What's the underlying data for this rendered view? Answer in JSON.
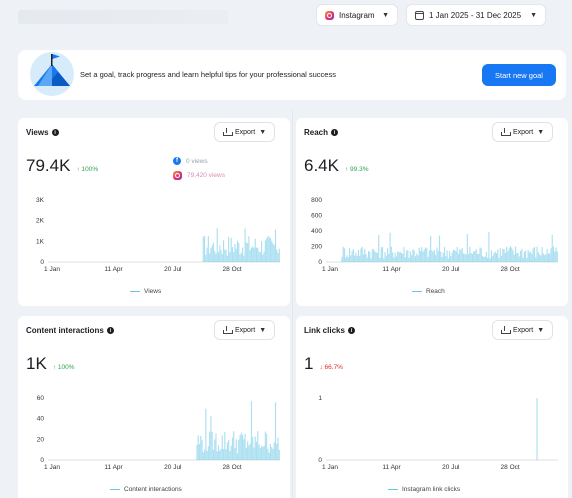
{
  "topbar": {
    "platform_label": "Instagram",
    "date_range_label": "1 Jan 2025 - 31 Dec 2025"
  },
  "goal_banner": {
    "text": "Set a goal, track progress and learn helpful tips for your professional success",
    "button_label": "Start new goal"
  },
  "export_label": "Export",
  "colors": {
    "accent": "#1877f2",
    "series": "#66c7e6",
    "up": "#31a24c",
    "down": "#e02e2e"
  },
  "cards": {
    "views": {
      "title": "Views",
      "value": "79.4K",
      "delta": "100%",
      "delta_direction": "up",
      "breakdown_facebook": "0 views",
      "breakdown_instagram": "79,420 views",
      "legend": "Views"
    },
    "reach": {
      "title": "Reach",
      "value": "6.4K",
      "delta": "99.3%",
      "delta_direction": "up",
      "legend": "Reach"
    },
    "content_interactions": {
      "title": "Content interactions",
      "value": "1K",
      "delta": "100%",
      "delta_direction": "up",
      "legend": "Content interactions"
    },
    "link_clicks": {
      "title": "Link clicks",
      "value": "1",
      "delta": "66.7%",
      "delta_direction": "down",
      "legend": "Instagram link clicks"
    }
  },
  "chart_data": [
    {
      "type": "area",
      "name": "views",
      "x_ticks": [
        "1 Jan",
        "11 Apr",
        "20 Jul",
        "28 Oct"
      ],
      "y_ticks": [
        "0",
        "1K",
        "2K",
        "3K"
      ],
      "ylim": [
        0,
        3000
      ],
      "series": [
        {
          "name": "Views",
          "values": [
            0,
            0,
            0,
            0,
            0,
            0,
            0,
            0,
            0,
            0,
            0,
            0,
            0,
            0,
            0,
            0,
            0,
            0,
            0,
            0,
            0,
            0,
            0,
            0,
            0,
            0,
            0,
            0,
            0,
            0,
            0,
            0,
            0,
            0,
            0,
            0,
            0,
            0,
            0,
            0,
            0,
            0,
            0,
            0,
            0,
            0,
            0,
            0,
            0,
            0,
            0,
            0,
            0,
            0,
            0,
            0,
            0,
            0,
            0,
            0,
            0,
            0,
            0,
            0,
            0,
            0,
            0,
            0,
            0,
            0,
            0,
            0,
            0,
            0,
            0,
            0,
            0,
            0,
            0,
            0,
            0,
            0,
            0,
            0,
            0,
            0,
            0,
            0,
            0,
            0,
            0,
            0,
            0,
            0,
            0,
            0,
            0,
            0,
            0,
            0,
            0,
            0,
            0,
            0,
            0,
            0,
            0,
            0,
            0,
            0,
            0,
            0,
            0,
            0,
            0,
            0,
            0,
            0,
            0,
            0,
            0,
            0,
            0,
            0,
            0,
            0,
            0,
            0,
            0,
            0,
            0,
            0,
            0,
            0,
            0,
            0,
            0,
            0,
            0,
            0,
            0,
            0,
            0,
            0,
            0,
            0,
            0,
            0,
            0,
            0,
            0,
            0,
            0,
            0,
            0,
            0,
            0,
            0,
            0,
            0,
            0,
            0,
            0,
            0,
            0,
            0,
            0,
            0,
            0,
            0,
            0,
            0,
            0,
            0,
            0,
            0,
            0,
            0,
            0,
            0,
            0,
            0,
            0,
            0,
            0,
            0,
            0,
            0,
            0,
            0,
            0,
            0,
            0,
            0,
            0,
            0,
            0,
            0,
            0,
            0,
            0,
            0,
            0,
            0,
            0,
            0,
            0,
            0,
            0,
            0,
            0,
            0,
            0,
            0,
            0,
            0,
            0,
            0,
            0,
            0,
            0,
            0,
            0,
            0,
            0,
            0,
            0,
            0,
            0,
            0,
            0,
            0,
            0,
            0,
            0,
            0,
            0,
            0,
            0,
            0,
            0,
            0,
            0,
            0,
            0,
            0,
            0,
            0,
            0,
            0,
            0,
            0,
            0,
            0,
            0,
            0,
            0,
            0,
            0,
            0,
            0,
            0,
            0,
            0,
            0,
            0,
            0,
            0,
            0,
            0,
            0,
            0,
            0,
            0,
            0,
            0,
            0,
            0,
            0,
            0,
            0,
            0,
            0,
            0,
            0,
            0,
            0,
            0,
            0,
            0,
            0,
            0,
            0,
            0,
            0,
            0,
            0,
            0,
            0,
            0,
            0,
            0,
            0,
            0,
            0,
            0,
            0,
            0,
            0,
            0,
            0,
            0,
            0,
            0,
            0,
            0,
            0,
            0,
            0,
            0,
            0,
            0,
            0,
            0,
            0,
            0,
            0,
            0,
            0,
            0,
            0,
            0,
            0,
            0,
            0,
            0,
            0,
            0,
            0,
            0,
            0,
            0,
            0,
            0,
            0,
            0,
            0,
            0,
            0,
            0,
            0,
            0,
            0,
            0,
            0,
            0,
            0,
            0,
            0,
            0,
            0,
            0,
            0,
            0,
            0,
            0,
            0,
            0,
            0,
            0,
            0,
            0,
            0,
            0,
            0,
            0,
            0,
            0,
            0,
            0,
            0
          ]
        }
      ],
      "activity": {
        "start_fraction": 0.66,
        "end_fraction": 1.0,
        "peak": 2000,
        "typical": 900
      }
    },
    {
      "type": "area",
      "name": "reach",
      "x_ticks": [
        "1 Jan",
        "11 Apr",
        "20 Jul",
        "28 Oct"
      ],
      "y_ticks": [
        "0",
        "200",
        "400",
        "600",
        "800"
      ],
      "ylim": [
        0,
        800
      ],
      "activity": {
        "start_fraction": 0.05,
        "end_fraction": 1.0,
        "peak": 430,
        "typical": 150
      }
    },
    {
      "type": "area",
      "name": "content_interactions",
      "x_ticks": [
        "1 Jan",
        "11 Apr",
        "20 Jul",
        "28 Oct"
      ],
      "y_ticks": [
        "0",
        "20",
        "40",
        "60"
      ],
      "ylim": [
        0,
        60
      ],
      "activity": {
        "start_fraction": 0.63,
        "end_fraction": 1.0,
        "peak": 60,
        "typical": 20
      }
    },
    {
      "type": "line",
      "name": "link_clicks",
      "x_ticks": [
        "1 Jan",
        "11 Apr",
        "20 Jul",
        "28 Oct"
      ],
      "y_ticks": [
        "0",
        "1"
      ],
      "ylim": [
        0,
        1
      ],
      "activity": {
        "spike_fraction": 0.905,
        "peak": 1
      }
    }
  ]
}
